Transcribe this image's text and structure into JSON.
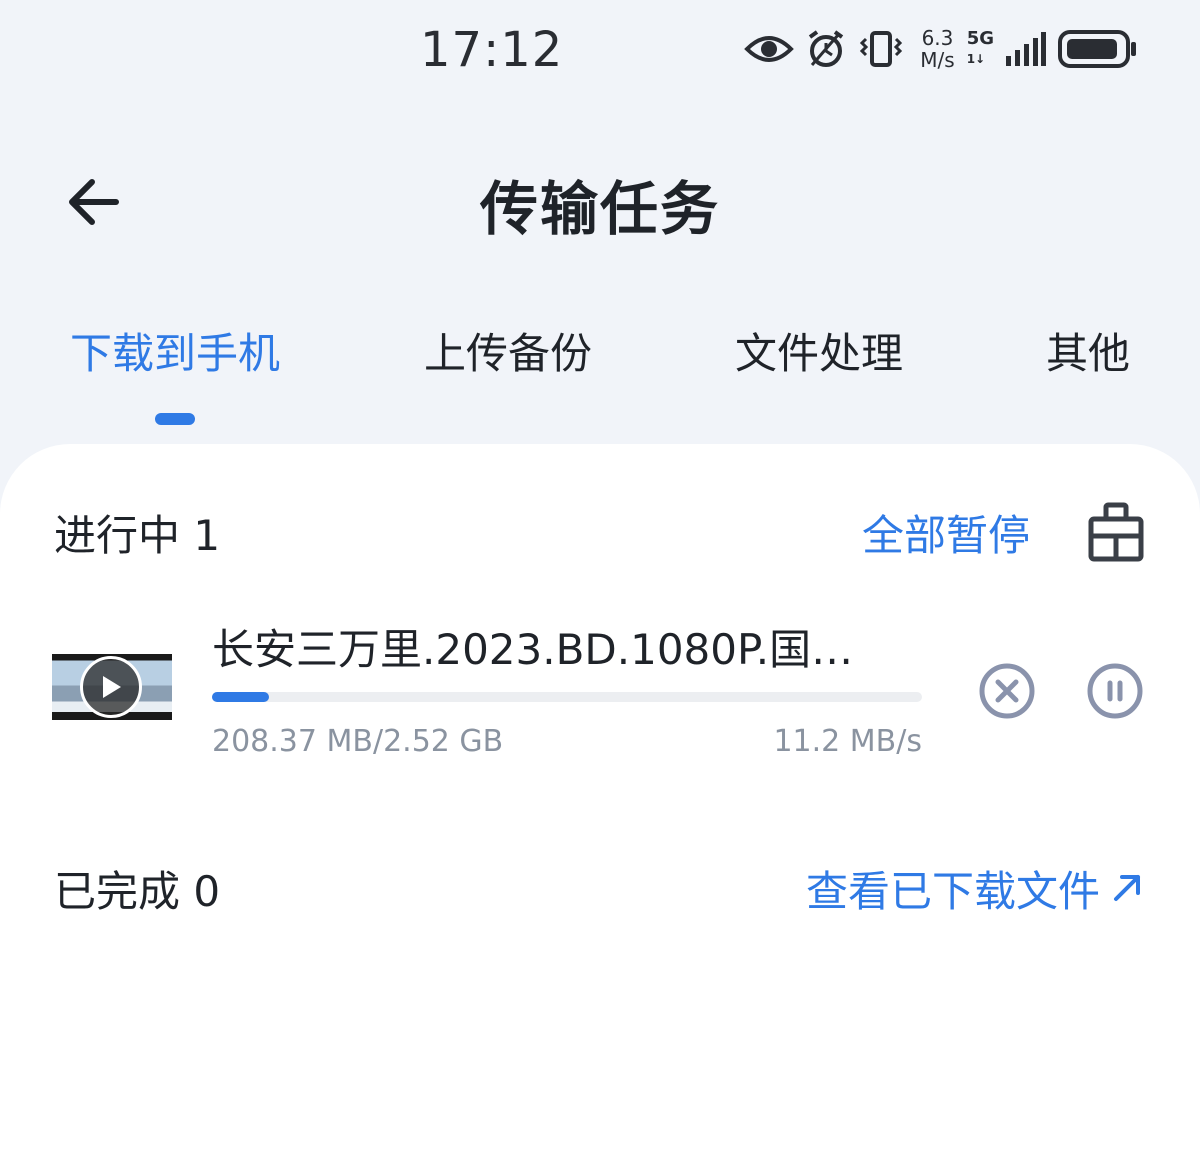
{
  "status_bar": {
    "time": "17:12",
    "speed_value": "6.3",
    "speed_unit": "M/s",
    "network": "5G",
    "network_sub": "1↓"
  },
  "header": {
    "title": "传输任务",
    "back_icon": "arrow-left-icon"
  },
  "tabs": [
    {
      "label": "下载到手机",
      "active": true
    },
    {
      "label": "上传备份",
      "active": false
    },
    {
      "label": "文件处理",
      "active": false
    },
    {
      "label": "其他",
      "active": false
    }
  ],
  "in_progress": {
    "title": "进行中 1",
    "pause_all_label": "全部暂停",
    "clear_icon": "broom-icon"
  },
  "task": {
    "file_name": "长安三万里.2023.BD.1080P.国…",
    "progress_fraction": 0.08,
    "size_text": "208.37 MB/2.52 GB",
    "speed_text": "11.2 MB/s"
  },
  "completed": {
    "title": "已完成 0",
    "view_files_label": "查看已下载文件",
    "view_files_icon": "arrow-up-right-icon"
  },
  "colors": {
    "accent": "#2f7ae5",
    "background": "#f1f4f9",
    "card": "#ffffff",
    "secondary_text": "#8a93a0",
    "icon_gray": "#8a93ac"
  }
}
